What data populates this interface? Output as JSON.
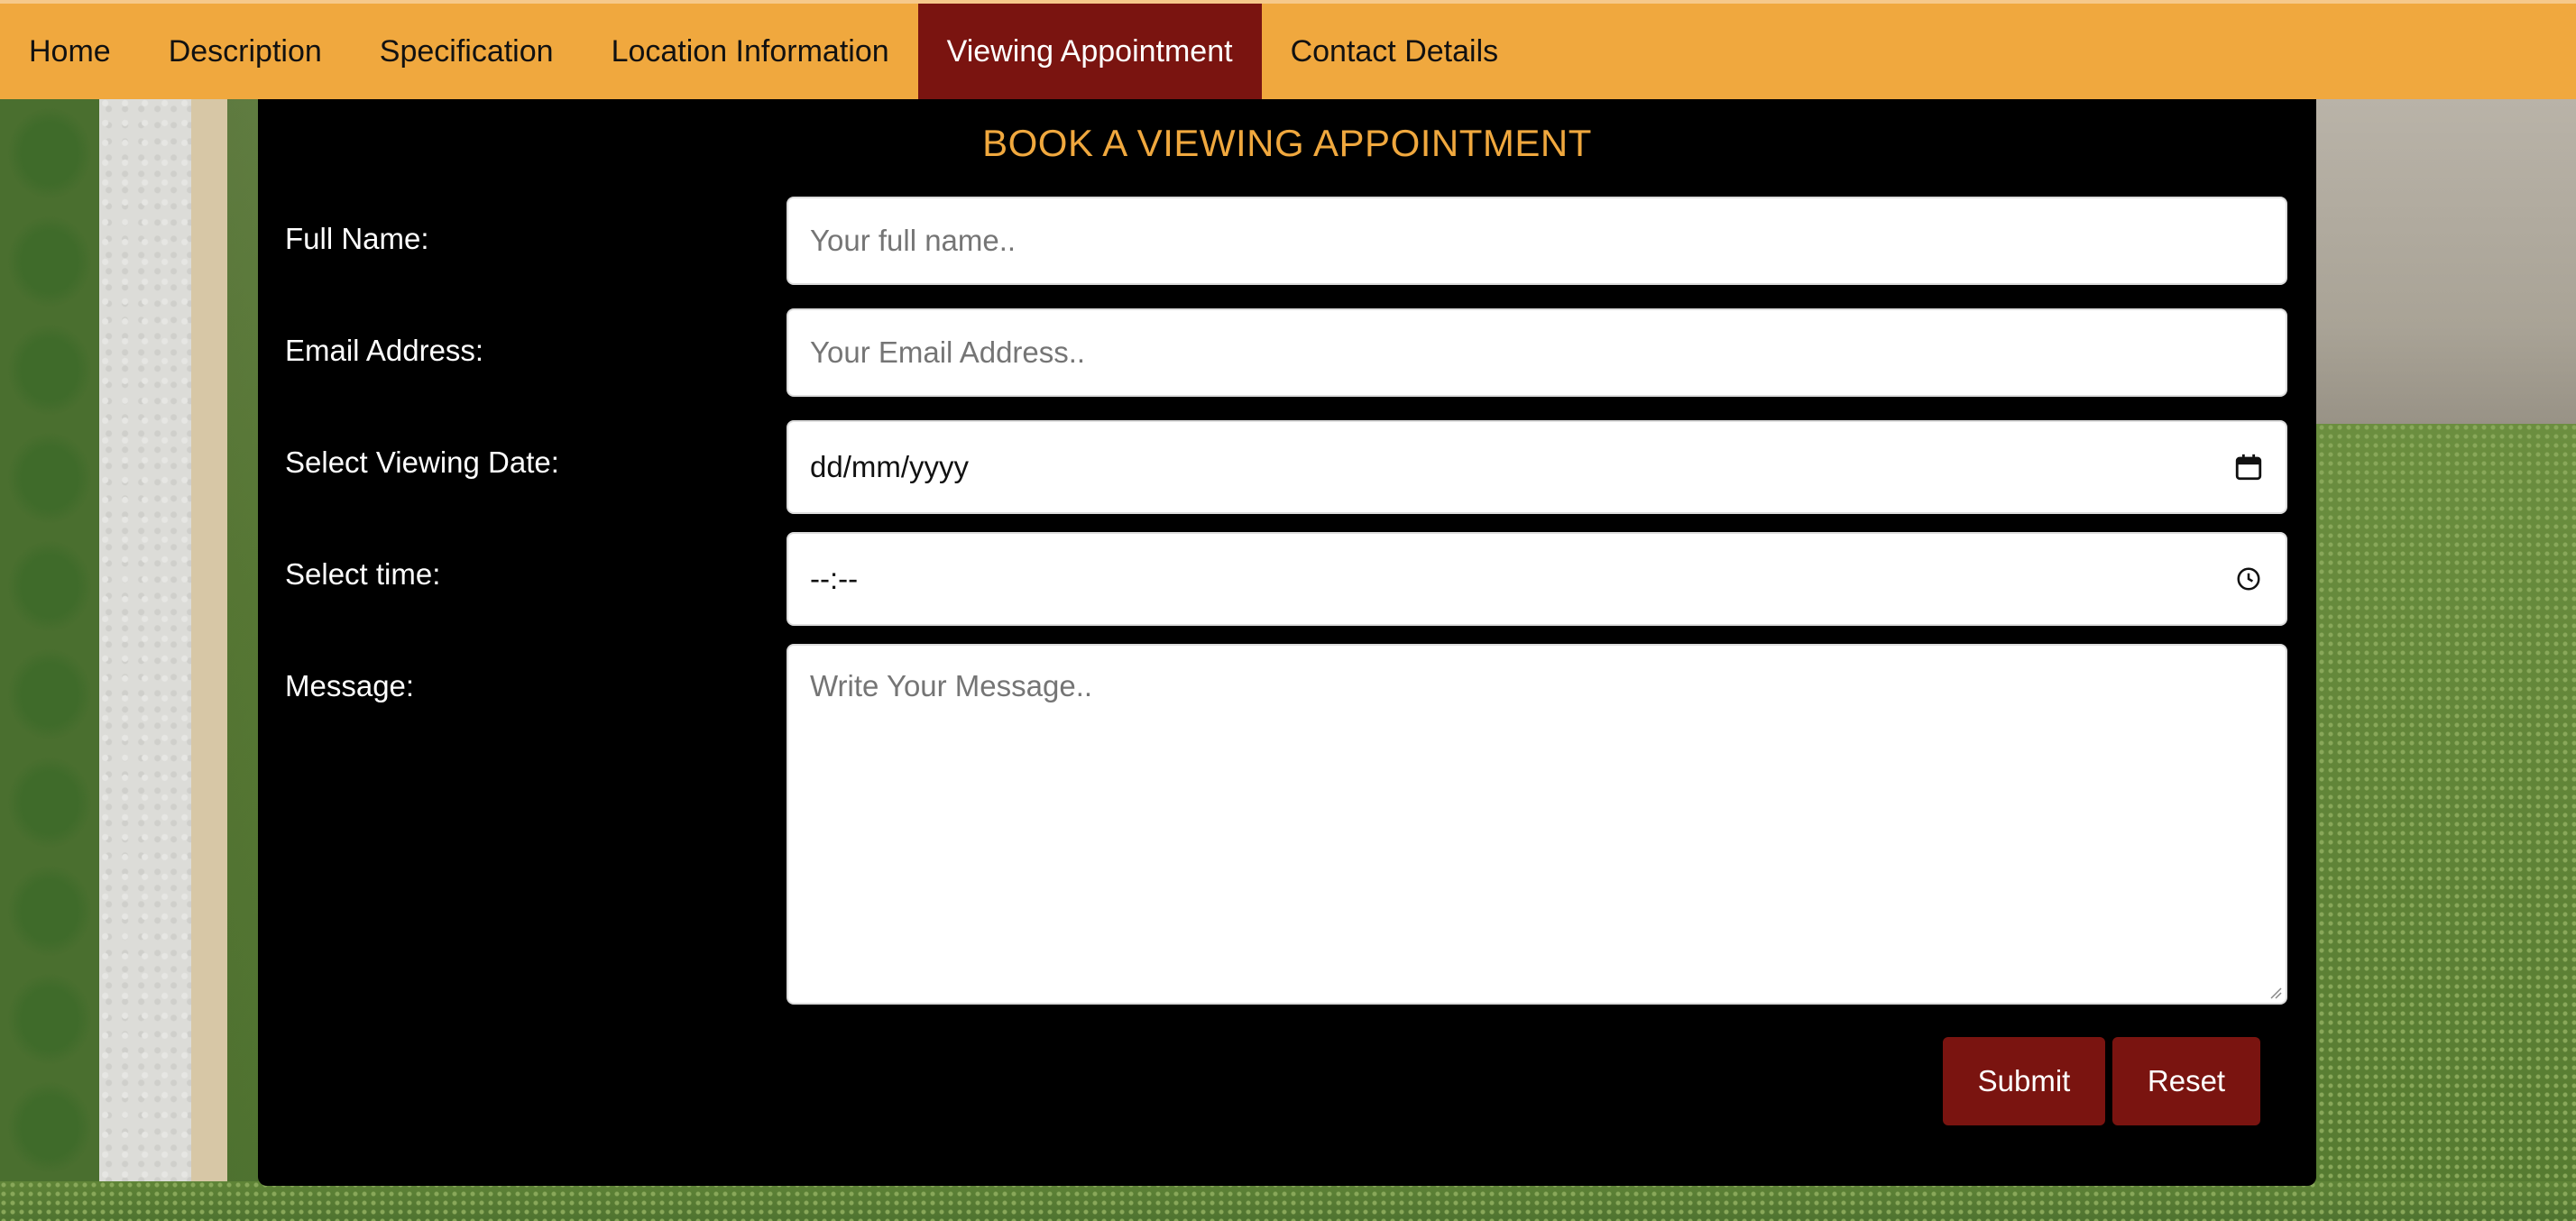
{
  "nav": {
    "items": [
      {
        "label": "Home"
      },
      {
        "label": "Description"
      },
      {
        "label": "Specification"
      },
      {
        "label": "Location Information"
      },
      {
        "label": "Viewing Appointment"
      },
      {
        "label": "Contact Details"
      }
    ],
    "active": "Viewing Appointment"
  },
  "form": {
    "title": "BOOK A VIEWING APPOINTMENT",
    "full_name": {
      "label": "Full Name:",
      "placeholder": "Your full name.."
    },
    "email": {
      "label": "Email Address:",
      "placeholder": "Your Email Address.."
    },
    "date": {
      "label": "Select Viewing Date:",
      "value": "dd/mm/yyyy",
      "icon": "calendar-icon"
    },
    "time": {
      "label": "Select time:",
      "value": "--:--",
      "icon": "clock-icon"
    },
    "message": {
      "label": "Message:",
      "placeholder": "Write Your Message.."
    },
    "submit_label": "Submit",
    "reset_label": "Reset"
  },
  "colors": {
    "nav_bg": "#f0a83e",
    "nav_active": "#7a1410",
    "title": "#f0a83e",
    "button": "#7a1410",
    "panel": "#000000"
  }
}
